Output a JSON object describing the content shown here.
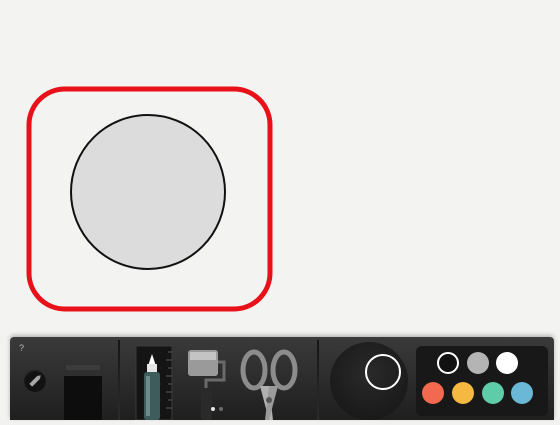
{
  "app": {
    "help_label": "?"
  },
  "drawing": {
    "highlight_color": "#e8111a",
    "shape_fill": "#dcdcdc",
    "shape_stroke": "#111111"
  },
  "toolbar": {
    "tools": [
      {
        "name": "eraser",
        "icon": "eraser-icon"
      },
      {
        "name": "marker",
        "icon": "marker-icon"
      },
      {
        "name": "roller",
        "icon": "paint-roller-icon"
      },
      {
        "name": "scissors",
        "icon": "scissors-icon"
      }
    ],
    "tool_pages": 2,
    "active_tool_page": 1
  },
  "palette": {
    "selected_index": 0,
    "colors": [
      "#111111",
      "#b4b4b4",
      "#ffffff",
      "#f2694f",
      "#f5b941",
      "#5fcca9",
      "#6bb7d6"
    ]
  }
}
